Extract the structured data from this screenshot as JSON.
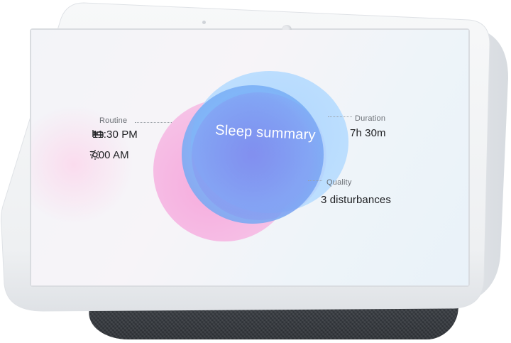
{
  "screen": {
    "center_title": "Sleep summary",
    "routine": {
      "label": "Routine",
      "bedtime": "11:30 PM",
      "wake_time": "7:00 AM",
      "bedtime_icon": "bed-icon",
      "wake_icon": "sun-icon"
    },
    "duration": {
      "label": "Duration",
      "value": "7h 30m"
    },
    "quality": {
      "label": "Quality",
      "value": "3 disturbances"
    }
  },
  "colors": {
    "bezel": "#f4f5f7",
    "speaker_fabric": "#3a3e44",
    "blob_pink": "#f6b8e3",
    "blob_blue": "#7cb2f7",
    "text_dark": "#202124",
    "text_label": "#6b6f75"
  }
}
